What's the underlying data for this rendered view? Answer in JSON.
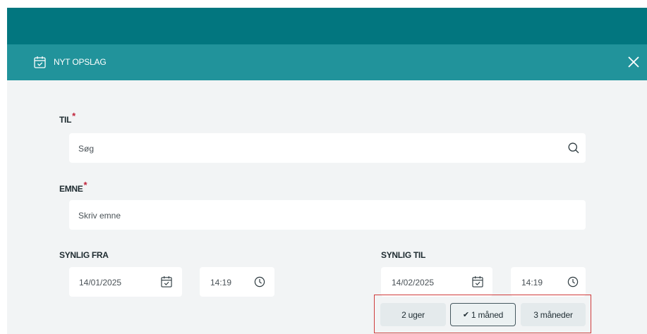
{
  "header": {
    "title": "NYT OPSLAG",
    "icon": "calendar-check-icon",
    "close_icon": "close-icon"
  },
  "to": {
    "label": "TIL",
    "required_mark": "*",
    "placeholder": "Søg",
    "icon": "search-icon"
  },
  "subject": {
    "label": "EMNE",
    "required_mark": "*",
    "placeholder": "Skriv emne"
  },
  "visible_from": {
    "label": "SYNLIG FRA",
    "date": "14/01/2025",
    "time": "14:19"
  },
  "visible_to": {
    "label": "SYNLIG TIL",
    "date": "14/02/2025",
    "time": "14:19"
  },
  "duration_options": [
    {
      "label": "2 uger",
      "selected": false
    },
    {
      "label": "1 måned",
      "selected": true,
      "check": "✔"
    },
    {
      "label": "3 måneder",
      "selected": false
    }
  ],
  "colors": {
    "top_bar": "#02767f",
    "header": "#21939b",
    "panel": "#f2f4f5",
    "required": "#c0233a",
    "highlight": "#cf3b3b"
  }
}
